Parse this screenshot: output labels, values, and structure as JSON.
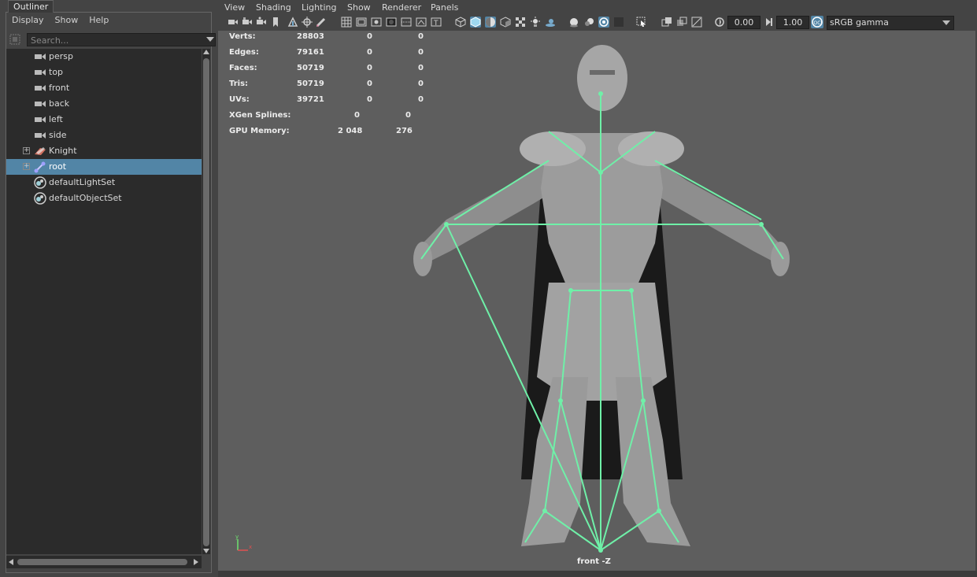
{
  "outliner": {
    "title": "Outliner",
    "menu": [
      "Display",
      "Show",
      "Help"
    ],
    "search_placeholder": "Search...",
    "items": [
      {
        "label": "persp",
        "icon": "camera-icon"
      },
      {
        "label": "top",
        "icon": "camera-icon"
      },
      {
        "label": "front",
        "icon": "camera-icon"
      },
      {
        "label": "back",
        "icon": "camera-icon"
      },
      {
        "label": "left",
        "icon": "camera-icon"
      },
      {
        "label": "side",
        "icon": "camera-icon"
      },
      {
        "label": "Knight",
        "icon": "mesh-group-icon",
        "expandable": true
      },
      {
        "label": "root",
        "icon": "joint-icon",
        "expandable": true,
        "selected": true
      },
      {
        "label": "defaultLightSet",
        "icon": "set-icon"
      },
      {
        "label": "defaultObjectSet",
        "icon": "set-icon"
      }
    ]
  },
  "viewport": {
    "menu": [
      "View",
      "Shading",
      "Lighting",
      "Show",
      "Renderer",
      "Panels"
    ],
    "exposure": "0.00",
    "gamma": "1.00",
    "color_space": "sRGB gamma",
    "camera_label": "front -Z",
    "hud": [
      {
        "label": "Verts:",
        "v1": "28803",
        "v2": "0",
        "v3": "0"
      },
      {
        "label": "Edges:",
        "v1": "79161",
        "v2": "0",
        "v3": "0"
      },
      {
        "label": "Faces:",
        "v1": "50719",
        "v2": "0",
        "v3": "0"
      },
      {
        "label": "Tris:",
        "v1": "50719",
        "v2": "0",
        "v3": "0"
      },
      {
        "label": "UVs:",
        "v1": "39721",
        "v2": "0",
        "v3": "0"
      },
      {
        "label": "XGen Splines:",
        "v1": "",
        "v2": "0",
        "v3": "0"
      },
      {
        "label": "GPU Memory:",
        "v1": "",
        "v2": "2 048",
        "v3": "276"
      }
    ],
    "axis_labels": {
      "x": "x",
      "y": "y"
    }
  },
  "colors": {
    "selection": "#5285a6",
    "skeleton": "#6ff0a8",
    "viewport_bg": "#5e5e5e",
    "mesh": "#9a9a9a"
  }
}
